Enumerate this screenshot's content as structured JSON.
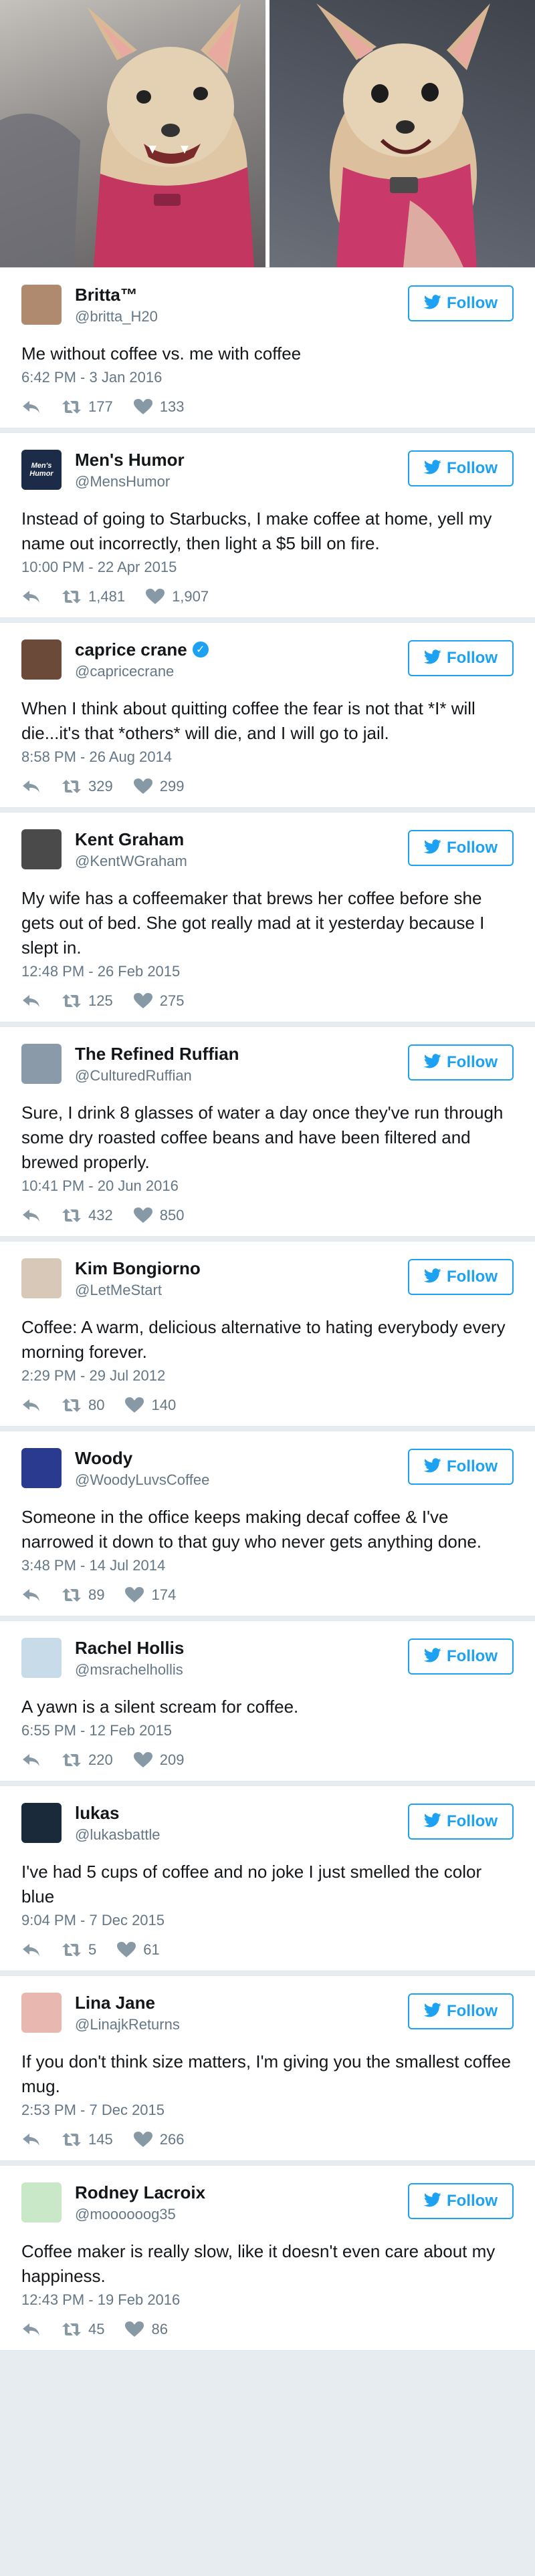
{
  "tweets": [
    {
      "name": "Britta™",
      "handle": "@britta_H20",
      "verified": false,
      "text": "Me without coffee vs. me with coffee",
      "time": "6:42 PM - 3 Jan 2016",
      "retweets": "177",
      "likes": "133",
      "avatar_color": "#b08a6f"
    },
    {
      "name": "Men's Humor",
      "handle": "@MensHumor",
      "verified": false,
      "text": "Instead of going to Starbucks, I make coffee at home, yell my name out incorrectly, then light a $5 bill on fire.",
      "time": "10:00 PM - 22 Apr 2015",
      "retweets": "1,481",
      "likes": "1,907",
      "avatar_color": "#1b2b48",
      "avatar_logo": "Men's Humor"
    },
    {
      "name": "caprice crane",
      "handle": "@capricecrane",
      "verified": true,
      "text": "When I think about quitting coffee the fear is not that *I* will die...it's that *others* will die, and I will go to jail.",
      "time": "8:58 PM - 26 Aug 2014",
      "retweets": "329",
      "likes": "299",
      "avatar_color": "#6b4a3a"
    },
    {
      "name": "Kent Graham",
      "handle": "@KentWGraham",
      "verified": false,
      "text": "My wife has a coffeemaker that brews her coffee before she gets out of bed. She got really mad at it yesterday because I slept in.",
      "time": "12:48 PM - 26 Feb 2015",
      "retweets": "125",
      "likes": "275",
      "avatar_color": "#4a4a4a"
    },
    {
      "name": "The Refined Ruffian",
      "handle": "@CulturedRuffian",
      "verified": false,
      "text": "Sure, I drink 8 glasses of water a day once they've run through some dry roasted coffee beans and have been filtered and brewed properly.",
      "time": "10:41 PM - 20 Jun 2016",
      "retweets": "432",
      "likes": "850",
      "avatar_color": "#8a9aa8"
    },
    {
      "name": "Kim Bongiorno",
      "handle": "@LetMeStart",
      "verified": false,
      "text": "Coffee: A warm, delicious alternative to hating everybody every morning forever.",
      "time": "2:29 PM - 29 Jul 2012",
      "retweets": "80",
      "likes": "140",
      "avatar_color": "#d8c8b8"
    },
    {
      "name": "Woody",
      "handle": "@WoodyLuvsCoffee",
      "verified": false,
      "text": "Someone in the office keeps making decaf coffee & I've narrowed it down to that guy who never gets anything done.",
      "time": "3:48 PM - 14 Jul 2014",
      "retweets": "89",
      "likes": "174",
      "avatar_color": "#2a3b8f"
    },
    {
      "name": "Rachel Hollis",
      "handle": "@msrachelhollis",
      "verified": false,
      "text": "A yawn is a silent scream for coffee.",
      "time": "6:55 PM - 12 Feb 2015",
      "retweets": "220",
      "likes": "209",
      "avatar_color": "#c8dbe8"
    },
    {
      "name": "lukas",
      "handle": "@lukasbattle",
      "verified": false,
      "text": "I've had 5 cups of coffee and no joke I just smelled the color blue",
      "time": "9:04 PM - 7 Dec 2015",
      "retweets": "5",
      "likes": "61",
      "avatar_color": "#1a2a3a"
    },
    {
      "name": "Lina Jane",
      "handle": "@LinajkReturns",
      "verified": false,
      "text": "If you don't think size matters, I'm giving you the smallest coffee mug.",
      "time": "2:53 PM - 7 Dec 2015",
      "retweets": "145",
      "likes": "266",
      "avatar_color": "#e8b8b0"
    },
    {
      "name": "Rodney Lacroix",
      "handle": "@moooooog35",
      "verified": false,
      "text": "Coffee maker is really slow, like it doesn't even care about my happiness.",
      "time": "12:43 PM - 19 Feb 2016",
      "retweets": "45",
      "likes": "86",
      "avatar_color": "#c8e8c8"
    }
  ],
  "follow_label": "Follow",
  "colors": {
    "accent": "#1da1f2",
    "meta": "#657786",
    "background": "#e6ecf0"
  },
  "icons": {
    "reply": "reply-icon",
    "retweet": "retweet-icon",
    "like": "heart-icon",
    "follow": "twitter-bird-icon",
    "verified": "verified-badge-icon"
  }
}
